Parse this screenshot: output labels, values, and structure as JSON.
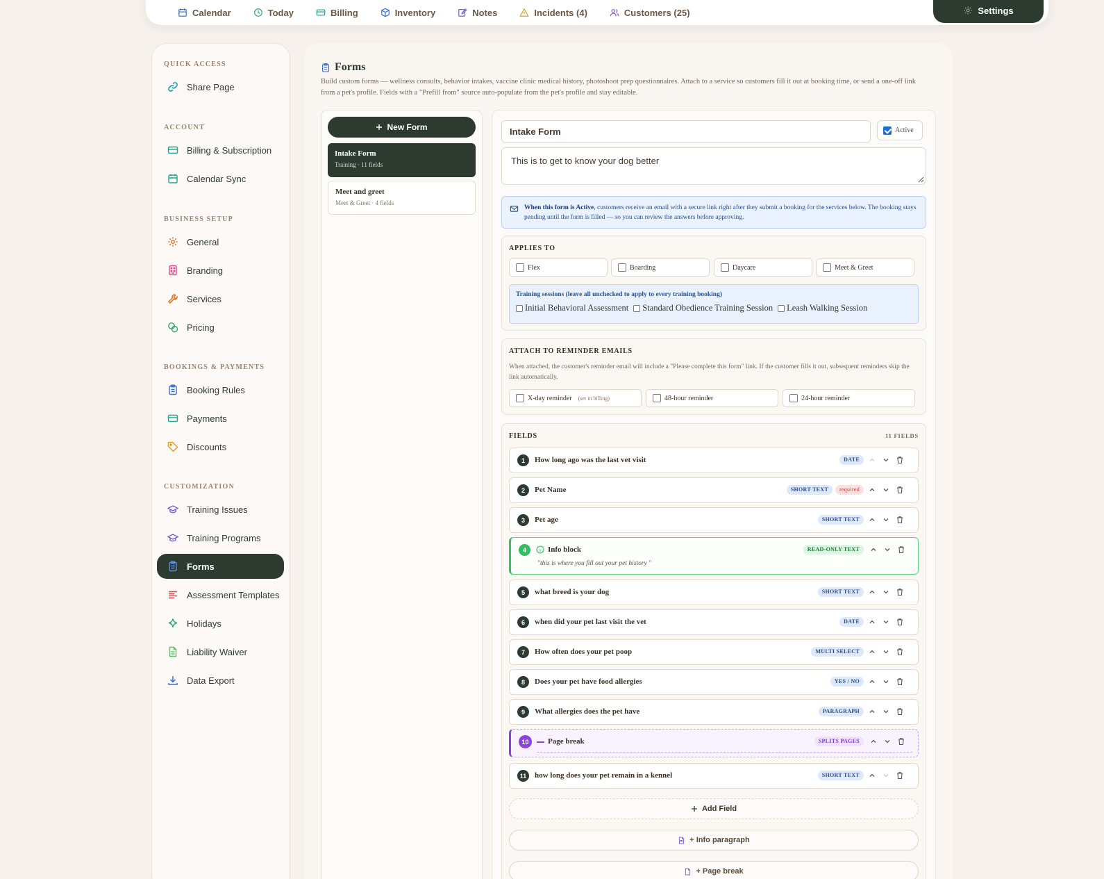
{
  "topnav": {
    "tabs": [
      {
        "label": "Calendar",
        "icon": "calendar-icon"
      },
      {
        "label": "Today",
        "icon": "clock-icon"
      },
      {
        "label": "Billing",
        "icon": "credit-card-icon"
      },
      {
        "label": "Inventory",
        "icon": "box-icon"
      },
      {
        "label": "Notes",
        "icon": "edit-icon"
      },
      {
        "label": "Incidents (4)",
        "icon": "warning-icon"
      },
      {
        "label": "Customers (25)",
        "icon": "users-icon"
      },
      {
        "label": "Settings",
        "icon": "gear-icon",
        "active": true
      }
    ]
  },
  "sidebar": {
    "sections": [
      {
        "title": "QUICK ACCESS",
        "items": [
          {
            "label": "Share Page",
            "icon": "link-icon"
          }
        ]
      },
      {
        "title": "ACCOUNT",
        "items": [
          {
            "label": "Billing & Subscription",
            "icon": "credit-card-icon"
          },
          {
            "label": "Calendar Sync",
            "icon": "calendar-icon"
          }
        ]
      },
      {
        "title": "BUSINESS SETUP",
        "items": [
          {
            "label": "General",
            "icon": "gear-icon"
          },
          {
            "label": "Branding",
            "icon": "palette-icon"
          },
          {
            "label": "Services",
            "icon": "wrench-icon"
          },
          {
            "label": "Pricing",
            "icon": "coins-icon"
          }
        ]
      },
      {
        "title": "BOOKINGS & PAYMENTS",
        "items": [
          {
            "label": "Booking Rules",
            "icon": "clipboard-icon"
          },
          {
            "label": "Payments",
            "icon": "credit-card-icon"
          },
          {
            "label": "Discounts",
            "icon": "tag-icon"
          }
        ]
      },
      {
        "title": "CUSTOMIZATION",
        "items": [
          {
            "label": "Training Issues",
            "icon": "graduation-cap-icon"
          },
          {
            "label": "Training Programs",
            "icon": "graduation-cap-icon"
          },
          {
            "label": "Forms",
            "icon": "clipboard-icon",
            "active": true
          },
          {
            "label": "Assessment Templates",
            "icon": "list-icon"
          },
          {
            "label": "Holidays",
            "icon": "sparkle-icon"
          },
          {
            "label": "Liability Waiver",
            "icon": "document-icon"
          },
          {
            "label": "Data Export",
            "icon": "download-icon"
          }
        ]
      }
    ]
  },
  "page": {
    "title": "Forms",
    "description": "Build custom forms — wellness consults, behavior intakes, vaccine clinic medical history, photoshoot prep questionnaires. Attach to a service so customers fill it out at booking time, or send a one-off link from a pet's profile. Fields with a \"Prefill from\" source auto-populate from the pet's profile and stay editable."
  },
  "forms_list": {
    "new_button": "New Form",
    "forms": [
      {
        "name": "Intake Form",
        "meta": "Training · 11 fields",
        "selected": true
      },
      {
        "name": "Meet and greet",
        "meta": "Meet & Greet · 4 fields",
        "selected": false
      }
    ]
  },
  "editor": {
    "name_value": "Intake Form",
    "active_label": "Active",
    "active_checked": true,
    "description_value": "This is to get to know your dog better",
    "banner_bold": "When this form is Active",
    "banner_text": ", customers receive an email with a secure link right after they submit a booking for the services below. The booking stays pending until the form is filled — so you can review the answers before approving.",
    "applies_to": {
      "title": "APPLIES TO",
      "options": [
        "Flex",
        "Boarding",
        "Daycare",
        "Meet & Greet"
      ],
      "training_heading": "Training sessions (leave all unchecked to apply to every training booking)",
      "training_options": [
        "Initial Behavioral Assessment",
        "Standard Obedience Training Session",
        "Leash Walking Session"
      ]
    },
    "reminders": {
      "title": "ATTACH TO REMINDER EMAILS",
      "description": "When attached, the customer's reminder email will include a \"Please complete this form\" link. If the customer fills it out, subsequent reminders skip the link automatically.",
      "options": [
        {
          "label": "X-day reminder",
          "note": "(set in billing)"
        },
        {
          "label": "48-hour reminder",
          "note": ""
        },
        {
          "label": "24-hour reminder",
          "note": ""
        }
      ]
    },
    "fields_section": {
      "title": "FIELDS",
      "count": "11 FIELDS",
      "fields": [
        {
          "n": "1",
          "label": "How long ago was the last vet visit",
          "type": "DATE"
        },
        {
          "n": "2",
          "label": "Pet Name",
          "type": "SHORT TEXT",
          "required": "required"
        },
        {
          "n": "3",
          "label": "Pet age",
          "type": "SHORT TEXT"
        },
        {
          "n": "4",
          "label": "Info block",
          "type": "READ-ONLY TEXT",
          "quote": "\"this is where you fill out your pet history \""
        },
        {
          "n": "5",
          "label": "what breed is your dog",
          "type": "SHORT TEXT"
        },
        {
          "n": "6",
          "label": "when did your pet last visit the vet",
          "type": "DATE"
        },
        {
          "n": "7",
          "label": "How often does your pet poop",
          "type": "MULTI SELECT"
        },
        {
          "n": "8",
          "label": "Does your pet have food allergies",
          "type": "YES / NO"
        },
        {
          "n": "9",
          "label": "What allergies does the pet have",
          "type": "PARAGRAPH"
        },
        {
          "n": "10",
          "label": "Page break",
          "type": "SPLITS PAGES"
        },
        {
          "n": "11",
          "label": "how long does your pet remain in a kennel",
          "type": "SHORT TEXT"
        }
      ],
      "add_field": "Add Field",
      "add_info": "+ Info paragraph",
      "add_pagebreak": "+ Page break"
    }
  },
  "colors": {
    "accent_dark": "#2c3a30",
    "info_blue": "#eaf2fd",
    "readonly_green": "#3bbf68",
    "pagebreak_purple": "#8a45d8"
  }
}
